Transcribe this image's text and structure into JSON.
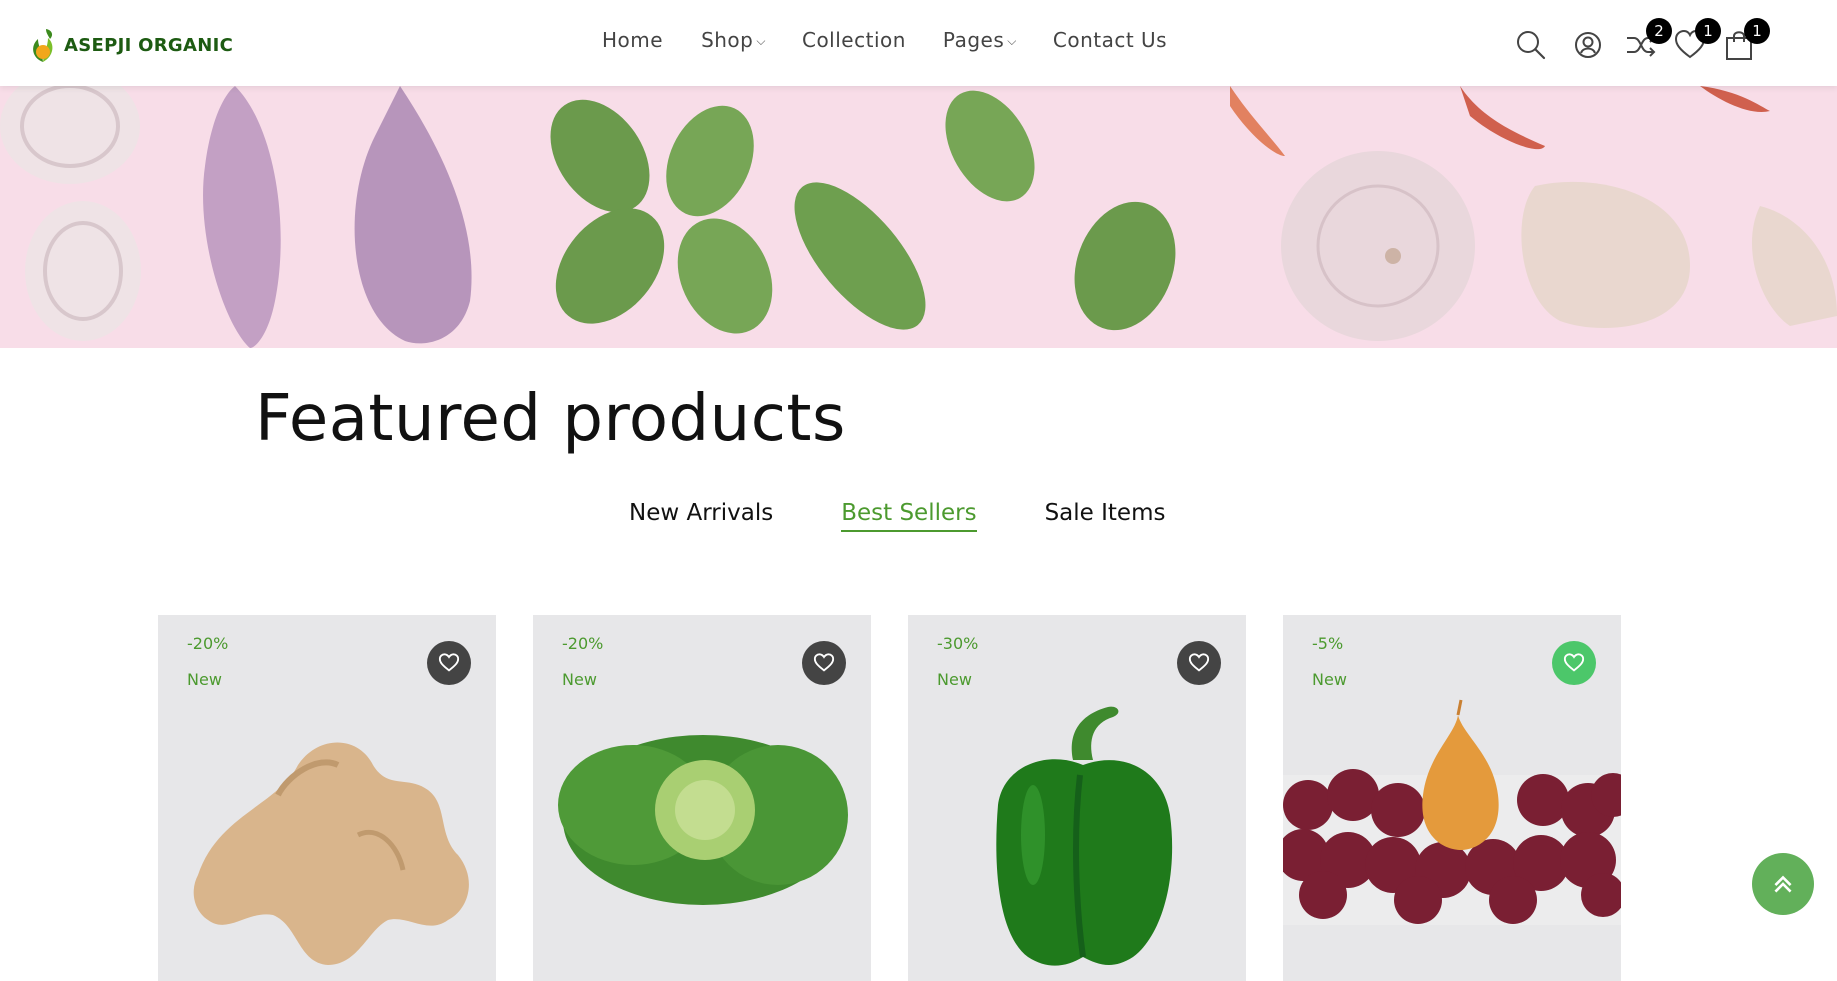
{
  "brand": {
    "name": "ASEPJI  ORGANIC"
  },
  "nav": {
    "items": [
      {
        "label": "Home",
        "dropdown": false
      },
      {
        "label": "Shop",
        "dropdown": true
      },
      {
        "label": "Collection",
        "dropdown": false
      },
      {
        "label": "Pages",
        "dropdown": true
      },
      {
        "label": "Contact Us",
        "dropdown": false
      }
    ]
  },
  "header_icons": {
    "search": "search-icon",
    "account": "user-icon",
    "compare": {
      "icon": "shuffle-icon",
      "count": "2"
    },
    "wishlist": {
      "icon": "heart-icon",
      "count": "1"
    },
    "cart": {
      "icon": "cart-icon",
      "count": "1"
    }
  },
  "section": {
    "title": "Featured products",
    "tabs": [
      {
        "label": "New Arrivals",
        "active": false
      },
      {
        "label": "Best Sellers",
        "active": true
      },
      {
        "label": "Sale Items",
        "active": false
      }
    ]
  },
  "products": [
    {
      "discount": "-20%",
      "tag": "New",
      "image": "ginger",
      "wishlisted": false
    },
    {
      "discount": "-20%",
      "tag": "New",
      "image": "cabbage",
      "wishlisted": false
    },
    {
      "discount": "-30%",
      "tag": "New",
      "image": "green-pepper",
      "wishlisted": false
    },
    {
      "discount": "-5%",
      "tag": "New",
      "image": "onions",
      "wishlisted": true
    }
  ],
  "colors": {
    "accent": "#4c9a2f",
    "banner_bg": "#f8dde8",
    "card_bg": "#e7e7e9",
    "wish_active": "#4cc76a",
    "scroll_top": "#62b05a"
  }
}
